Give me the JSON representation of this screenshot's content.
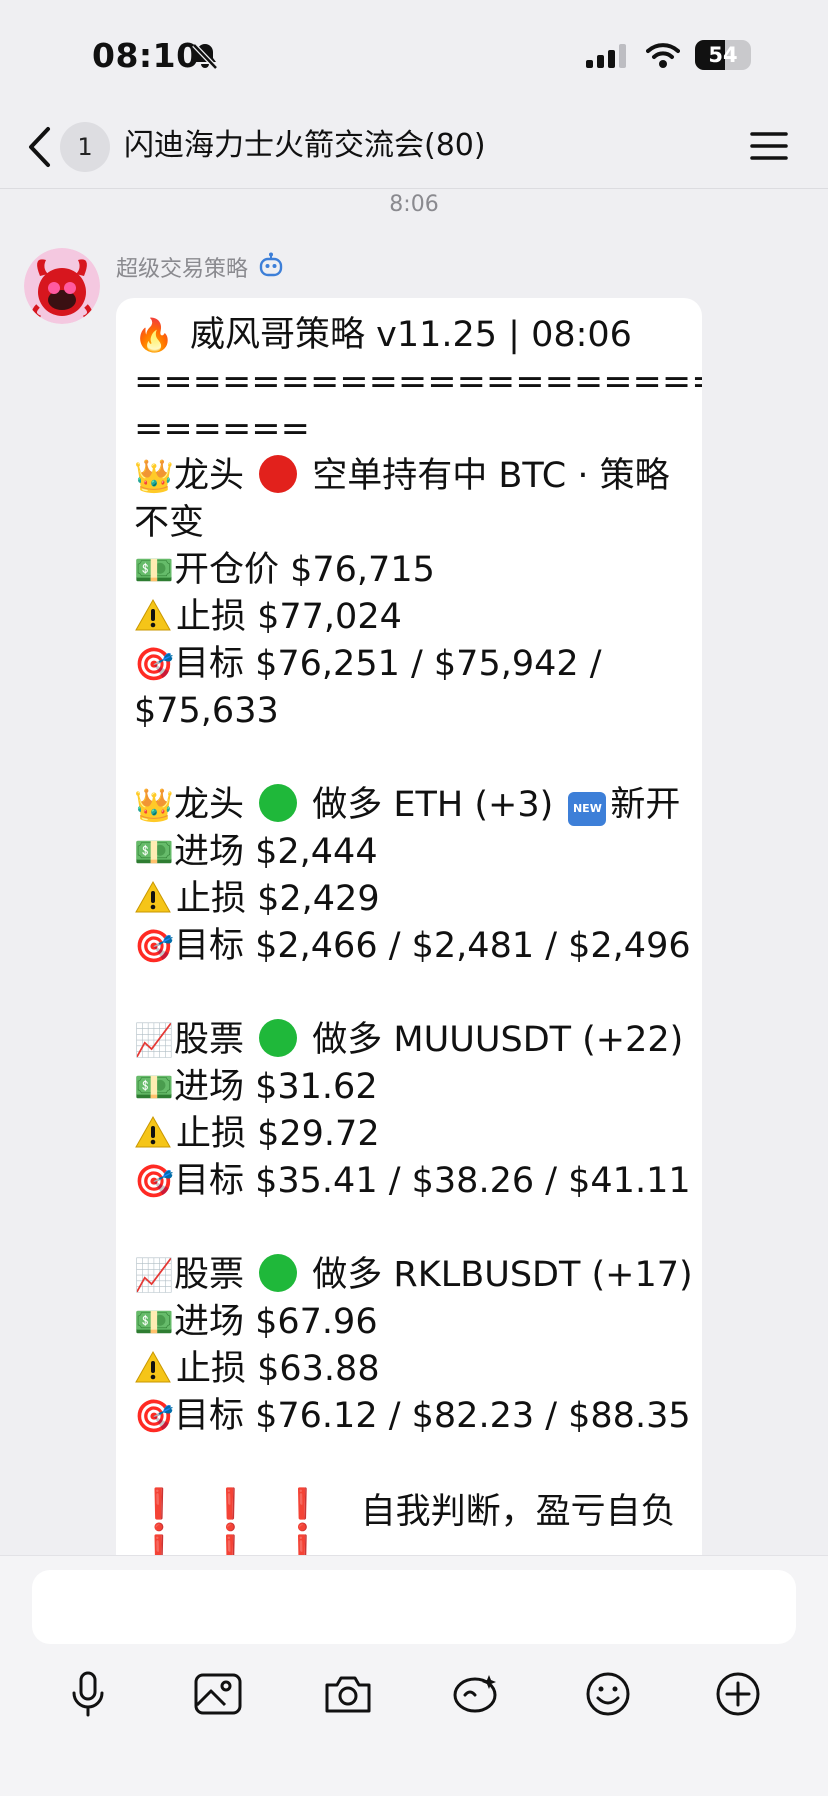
{
  "status_bar": {
    "time": "08:10",
    "battery_level": "54",
    "battery_percent": 54
  },
  "nav": {
    "back_label": "",
    "unread_count": "1",
    "title": "闪迪海力士火箭交流会(80)"
  },
  "chat": {
    "timestamp": "8:06",
    "sender": "超级交易策略",
    "message": {
      "l01": "威风哥策略 v11.25 | 08:06",
      "l02": "===========================",
      "l03": "======",
      "l04a": "龙头",
      "l04b": "空单持有中 BTC · 策略",
      "l05": "不变",
      "l06": "开仓价 $76,715",
      "l07": "止损 $77,024",
      "l08": "目标 $76,251 / $75,942 /",
      "l09": "$75,633",
      "l11a": "龙头",
      "l11b": "做多 ETH (+3)",
      "l11c": "新开",
      "l12": "进场 $2,444",
      "l13": "止损 $2,429",
      "l14": "目标 $2,466 / $2,481 / $2,496",
      "l16a": "股票",
      "l16b": "做多 MUUUSDT (+22)",
      "l17": "进场 $31.62",
      "l18": "止损 $29.72",
      "l19": "目标 $35.41 / $38.26 / $41.11",
      "l21a": "股票",
      "l21b": "做多 RKLBUSDT (+17)",
      "l22": "进场 $67.96",
      "l23": "止损 $63.88",
      "l24": "目标 $76.12 / $82.23 / $88.35",
      "l26a": "❗❗❗",
      "l26b": "自我判断，盈亏自负",
      "new_badge": "NEW"
    }
  },
  "composer": {
    "placeholder": ""
  },
  "icons": {
    "crown": "👑",
    "money": "💵",
    "target": "🎯",
    "fire": "🔥",
    "chart": "📈"
  },
  "colors": {
    "red_dot": "#e2211c",
    "green_dot": "#1fb83a",
    "warn": "#f5c518",
    "accent": "#3d7fd8"
  }
}
